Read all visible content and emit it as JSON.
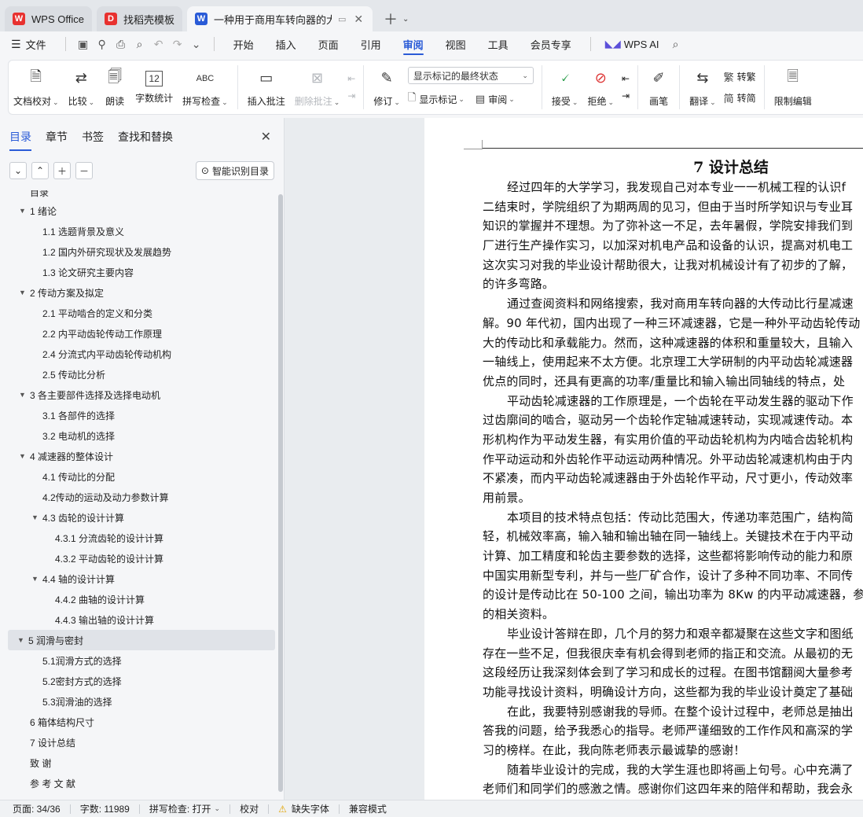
{
  "tabs": [
    {
      "label": "WPS Office",
      "icon": "wps-logo-icon",
      "color": "#e8312f"
    },
    {
      "label": "找稻壳模板",
      "icon": "docer-logo-icon",
      "color": "#e8312f"
    },
    {
      "label": "一种用于商用车转向器的大传动",
      "icon": "writer-logo-icon",
      "color": "#2a5bd7"
    }
  ],
  "menubar": {
    "file_label": "文件",
    "items": [
      "开始",
      "插入",
      "页面",
      "引用",
      "审阅",
      "视图",
      "工具",
      "会员专享"
    ],
    "active": "审阅",
    "wps_ai": "WPS AI"
  },
  "ribbon": {
    "doc_check": "文档校对",
    "compare": "比较",
    "read_aloud": "朗读",
    "word_count": "字数统计",
    "spell_check": "拼写检查",
    "insert_comment": "插入批注",
    "delete_comment": "删除批注",
    "revise": "修订",
    "markup_select": "显示标记的最终状态",
    "show_markup": "显示标记",
    "review": "审阅",
    "accept": "接受",
    "reject": "拒绝",
    "brush": "画笔",
    "translate": "翻译",
    "to_traditional": "转繁",
    "to_simplified": "转简",
    "restrict_edit": "限制编辑"
  },
  "nav": {
    "tabs": [
      "目录",
      "章节",
      "书签",
      "查找和替换"
    ],
    "active_tab": "目录",
    "smart_button": "智能识别目录",
    "toc": [
      {
        "text": "目录",
        "level": 0,
        "arrow": "",
        "cut": true
      },
      {
        "text": "1  绪论",
        "level": 1,
        "arrow": "▼"
      },
      {
        "text": "1.1  选题背景及意义",
        "level": 2,
        "arrow": ""
      },
      {
        "text": "1.2  国内外研究现状及发展趋势",
        "level": 2,
        "arrow": ""
      },
      {
        "text": "1.3  论文研究主要内容",
        "level": 2,
        "arrow": ""
      },
      {
        "text": "2  传动方案及拟定",
        "level": 1,
        "arrow": "▼"
      },
      {
        "text": "2.1  平动啮合的定义和分类",
        "level": 2,
        "arrow": ""
      },
      {
        "text": "2.2  内平动齿轮传动工作原理",
        "level": 2,
        "arrow": ""
      },
      {
        "text": "2.4  分流式内平动齿轮传动机构",
        "level": 2,
        "arrow": ""
      },
      {
        "text": "2.5  传动比分析",
        "level": 2,
        "arrow": ""
      },
      {
        "text": "3  各主要部件选择及选择电动机",
        "level": 1,
        "arrow": "▼"
      },
      {
        "text": "3.1  各部件的选择",
        "level": 2,
        "arrow": ""
      },
      {
        "text": "3.2  电动机的选择",
        "level": 2,
        "arrow": ""
      },
      {
        "text": "4  减速器的整体设计",
        "level": 1,
        "arrow": "▼"
      },
      {
        "text": "4.1  传动比的分配",
        "level": 2,
        "arrow": ""
      },
      {
        "text": "4.2传动的运动及动力参数计算",
        "level": 2,
        "arrow": ""
      },
      {
        "text": "4.3  齿轮的设计计算",
        "level": 2,
        "arrow": "▼"
      },
      {
        "text": "4.3.1  分流齿轮的设计计算",
        "level": 3,
        "arrow": ""
      },
      {
        "text": "4.3.2  平动齿轮的设计计算",
        "level": 3,
        "arrow": ""
      },
      {
        "text": "4.4  轴的设计计算",
        "level": 2,
        "arrow": "▼"
      },
      {
        "text": "4.4.2  曲轴的设计计算",
        "level": 3,
        "arrow": ""
      },
      {
        "text": "4.4.3  输出轴的设计计算",
        "level": 3,
        "arrow": ""
      },
      {
        "text": "5  润滑与密封",
        "level": 1,
        "arrow": "▼",
        "selected": true
      },
      {
        "text": "5.1润滑方式的选择",
        "level": 2,
        "arrow": ""
      },
      {
        "text": "5.2密封方式的选择",
        "level": 2,
        "arrow": ""
      },
      {
        "text": "5.3润滑油的选择",
        "level": 2,
        "arrow": ""
      },
      {
        "text": "6  箱体结构尺寸",
        "level": 1,
        "arrow": ""
      },
      {
        "text": "7  设计总结",
        "level": 1,
        "arrow": ""
      },
      {
        "text": "致    谢",
        "level": 1,
        "arrow": ""
      },
      {
        "text": "参 考 文 献",
        "level": 1,
        "arrow": ""
      }
    ]
  },
  "document": {
    "title": "7  设计总结",
    "lines": [
      {
        "t": "经过四年的大学学习，我发现自己对本专业一一机械工程的认识f",
        "i": true
      },
      {
        "t": "二结束时，学院组织了为期两周的见习，但由于当时所学知识与专业耳",
        "i": false
      },
      {
        "t": "知识的掌握并不理想。为了弥补这一不足，去年暑假，学院安排我们到",
        "i": false
      },
      {
        "t": "厂进行生产操作实习，以加深对机电产品和设备的认识，提高对机电工",
        "i": false
      },
      {
        "t": "这次实习对我的毕业设计帮助很大，让我对机械设计有了初步的了解，",
        "i": false
      },
      {
        "t": "的许多弯路。",
        "i": false
      },
      {
        "t": "通过查阅资料和网络搜索，我对商用车转向器的大传动比行星减速",
        "i": true
      },
      {
        "t": "解。90 年代初，国内出现了一种三环减速器，它是一种外平动齿轮传动",
        "i": false
      },
      {
        "t": "大的传动比和承载能力。然而，这种减速器的体积和重量较大，且输入",
        "i": false
      },
      {
        "t": "一轴线上，使用起来不太方便。北京理工大学研制的内平动齿轮减速器",
        "i": false
      },
      {
        "t": "优点的同时，还具有更高的功率/重量比和输入输出同轴线的特点，处",
        "i": false
      },
      {
        "t": "平动齿轮减速器的工作原理是，一个齿轮在平动发生器的驱动下作",
        "i": true
      },
      {
        "t": "过齿廓间的啮合，驱动另一个齿轮作定轴减速转动，实现减速传动。本",
        "i": false
      },
      {
        "t": "形机构作为平动发生器，有实用价值的平动齿轮机构为内啮合齿轮机构",
        "i": false
      },
      {
        "t": "作平动运动和外齿轮作平动运动两种情况。外平动齿轮减速机构由于内",
        "i": false
      },
      {
        "t": "不紧凑，而内平动齿轮减速器由于外齿轮作平动，尺寸更小，传动效率",
        "i": false
      },
      {
        "t": "用前景。",
        "i": false
      },
      {
        "t": "本项目的技术特点包括：传动比范围大，传递功率范围广，结构简",
        "i": true
      },
      {
        "t": "轻，机械效率高，输入轴和输出轴在同一轴线上。关键技术在于内平动",
        "i": false
      },
      {
        "t": "计算、加工精度和轮齿主要参数的选择，这些都将影响传动的能力和原",
        "i": false
      },
      {
        "t": "中国实用新型专利，并与一些厂矿合作，设计了多种不同功率、不同传",
        "i": false
      },
      {
        "t": "的设计是传动比在 50-100 之间，输出功率为 8Kw 的内平动减速器，参",
        "i": false
      },
      {
        "t": "的相关资料。",
        "i": false
      },
      {
        "t": "毕业设计答辩在即，几个月的努力和艰辛都凝聚在这些文字和图纸",
        "i": true
      },
      {
        "t": "存在一些不足，但我很庆幸有机会得到老师的指正和交流。从最初的无",
        "i": false
      },
      {
        "t": "这段经历让我深刻体会到了学习和成长的过程。在图书馆翻阅大量参考",
        "i": false
      },
      {
        "t": "功能寻找设计资料，明确设计方向，这些都为我的毕业设计奠定了基础",
        "i": false
      },
      {
        "t": "在此，我要特别感谢我的导师。在整个设计过程中，老师总是抽出",
        "i": true
      },
      {
        "t": "答我的问题，给予我悉心的指导。老师严谨细致的工作作风和高深的学",
        "i": false
      },
      {
        "t": "习的榜样。在此，我向陈老师表示最诚挚的感谢！",
        "i": false
      },
      {
        "t": "随着毕业设计的完成，我的大学生涯也即将画上句号。心中充满了",
        "i": true
      },
      {
        "t": "老师们和同学们的感激之情。感谢你们这四年来的陪伴和帮助，我会永",
        "i": false
      }
    ]
  },
  "status": {
    "page": "页面: 34/36",
    "words": "字数: 11989",
    "spell": "拼写检查: 打开",
    "proof": "校对",
    "missing_font": "缺失字体",
    "compat": "兼容模式"
  }
}
